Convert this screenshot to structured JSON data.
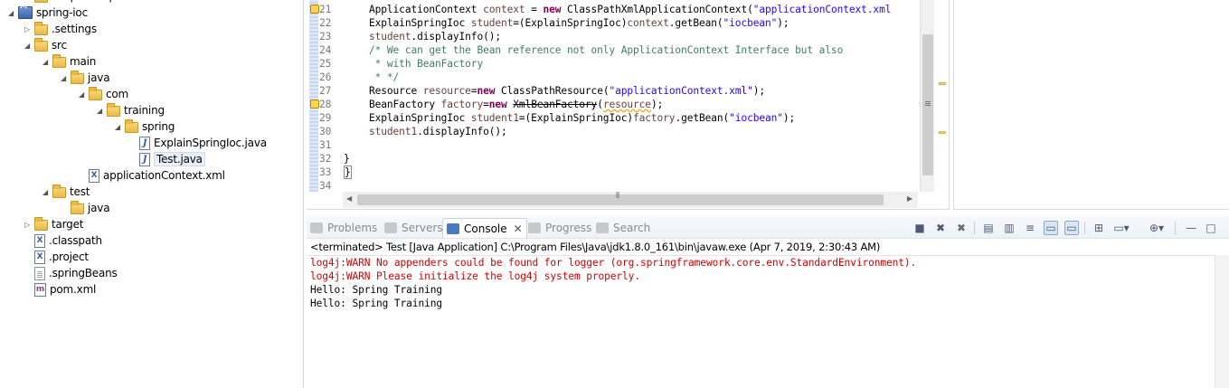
{
  "explorer": {
    "items": [
      {
        "label": "simplesetup",
        "depth": 1,
        "twisty": "",
        "icon": "folder"
      },
      {
        "label": "spring-ioc",
        "depth": 0,
        "twisty": "open",
        "icon": "project"
      },
      {
        "label": ".settings",
        "depth": 1,
        "twisty": "closed",
        "icon": "folder"
      },
      {
        "label": "src",
        "depth": 1,
        "twisty": "open",
        "icon": "folder"
      },
      {
        "label": "main",
        "depth": 2,
        "twisty": "open",
        "icon": "folder"
      },
      {
        "label": "java",
        "depth": 3,
        "twisty": "open",
        "icon": "folder"
      },
      {
        "label": "com",
        "depth": 4,
        "twisty": "open",
        "icon": "folder"
      },
      {
        "label": "training",
        "depth": 5,
        "twisty": "open",
        "icon": "folder"
      },
      {
        "label": "spring",
        "depth": 6,
        "twisty": "open",
        "icon": "folder"
      },
      {
        "label": "ExplainSpringIoc.java",
        "depth": 7,
        "twisty": "",
        "icon": "java"
      },
      {
        "label": "Test.java",
        "depth": 7,
        "twisty": "",
        "icon": "java",
        "selected": true
      },
      {
        "label": "applicationContext.xml",
        "depth": 4,
        "twisty": "",
        "icon": "xml"
      },
      {
        "label": "test",
        "depth": 2,
        "twisty": "open",
        "icon": "folder"
      },
      {
        "label": "java",
        "depth": 3,
        "twisty": "",
        "icon": "folder"
      },
      {
        "label": "target",
        "depth": 1,
        "twisty": "closed",
        "icon": "folder"
      },
      {
        "label": ".classpath",
        "depth": 1,
        "twisty": "",
        "icon": "xml"
      },
      {
        "label": ".project",
        "depth": 1,
        "twisty": "",
        "icon": "xml"
      },
      {
        "label": ".springBeans",
        "depth": 1,
        "twisty": "",
        "icon": "plain"
      },
      {
        "label": "pom.xml",
        "depth": 1,
        "twisty": "",
        "icon": "pom"
      }
    ]
  },
  "editor": {
    "lines": [
      {
        "n": "21",
        "marker": true,
        "tokens": [
          [
            "",
            "ApplicationContext "
          ],
          [
            "var",
            "context"
          ],
          [
            "",
            " = "
          ],
          [
            "kw",
            "new"
          ],
          [
            "",
            " ClassPathXmlApplicationContext("
          ],
          [
            "str",
            "\"applicationContext.xml"
          ]
        ]
      },
      {
        "n": "22",
        "tokens": [
          [
            "",
            "ExplainSpringIoc "
          ],
          [
            "var",
            "student"
          ],
          [
            "",
            "=(ExplainSpringIoc)"
          ],
          [
            "var",
            "context"
          ],
          [
            "",
            ".getBean("
          ],
          [
            "str",
            "\"iocbean\""
          ],
          [
            "",
            ");"
          ]
        ]
      },
      {
        "n": "23",
        "tokens": [
          [
            "var",
            "student"
          ],
          [
            "",
            ".displayInfo();"
          ]
        ]
      },
      {
        "n": "24",
        "tokens": [
          [
            "cmt",
            "/* We can get the Bean reference not only ApplicationContext Interface but also"
          ]
        ]
      },
      {
        "n": "25",
        "tokens": [
          [
            "cmt",
            " * with BeanFactory"
          ]
        ]
      },
      {
        "n": "26",
        "tokens": [
          [
            "cmt",
            " * */"
          ]
        ]
      },
      {
        "n": "27",
        "tokens": [
          [
            "",
            "Resource "
          ],
          [
            "var",
            "resource"
          ],
          [
            "",
            "="
          ],
          [
            "kw",
            "new"
          ],
          [
            "",
            " ClassPathResource("
          ],
          [
            "str",
            "\"applicationContext.xml\""
          ],
          [
            "",
            ");"
          ]
        ]
      },
      {
        "n": "28",
        "marker": true,
        "tokens": [
          [
            "",
            "BeanFactory "
          ],
          [
            "var",
            "factory"
          ],
          [
            "",
            "="
          ],
          [
            "kw",
            "new"
          ],
          [
            "",
            " "
          ],
          [
            "dep",
            "XmlBeanFactory"
          ],
          [
            "",
            "("
          ],
          [
            "var warnsq",
            "resource"
          ],
          [
            "",
            ");"
          ]
        ]
      },
      {
        "n": "29",
        "tokens": [
          [
            "",
            "ExplainSpringIoc "
          ],
          [
            "var",
            "student1"
          ],
          [
            "",
            "=(ExplainSpringIoc)"
          ],
          [
            "var",
            "factory"
          ],
          [
            "",
            ".getBean("
          ],
          [
            "str",
            "\"iocbean\""
          ],
          [
            "",
            ");"
          ]
        ]
      },
      {
        "n": "30",
        "tokens": [
          [
            "var",
            "student1"
          ],
          [
            "",
            ".displayInfo();"
          ]
        ]
      },
      {
        "n": "31",
        "tokens": []
      },
      {
        "n": "32",
        "tokens": [
          [
            "",
            "}"
          ]
        ],
        "indent": "outer"
      },
      {
        "n": "33",
        "tokens": [
          [
            "brace-box",
            "}"
          ]
        ],
        "indent": "class"
      },
      {
        "n": "34",
        "tokens": []
      }
    ]
  },
  "console": {
    "tabs": [
      {
        "label": "Problems",
        "icon": "problems-icon",
        "color": "#c8c8c8"
      },
      {
        "label": "Servers",
        "icon": "servers-icon",
        "color": "#c8c8c8"
      },
      {
        "label": "Console",
        "icon": "console-icon",
        "color": "#4a78c2",
        "active": true
      },
      {
        "label": "Progress",
        "icon": "progress-icon",
        "color": "#c8c8c8"
      },
      {
        "label": "Search",
        "icon": "search-icon",
        "color": "#c8c8c8"
      }
    ],
    "header": "<terminated> Test [Java Application] C:\\Program Files\\Java\\jdk1.8.0_161\\bin\\javaw.exe (Apr 7, 2019, 2:30:43 AM)",
    "output": [
      {
        "text": "log4j:WARN No appenders could be found for logger (org.springframework.core.env.StandardEnvironment).",
        "kind": "err"
      },
      {
        "text": "log4j:WARN Please initialize the log4j system properly.",
        "kind": "err"
      },
      {
        "text": "Hello: Spring Training",
        "kind": "out"
      },
      {
        "text": "Hello: Spring Training",
        "kind": "out"
      }
    ],
    "toolbar": [
      {
        "name": "terminate-button",
        "glyph": "■"
      },
      {
        "name": "remove-launch-button",
        "glyph": "✖"
      },
      {
        "name": "remove-all-terminated-button",
        "glyph": "✖"
      },
      {
        "name": "clear-console-button",
        "glyph": "▤"
      },
      {
        "name": "scroll-lock-button",
        "glyph": "▥"
      },
      {
        "name": "word-wrap-button",
        "glyph": "≡"
      },
      {
        "name": "show-on-stdout-button",
        "glyph": "▭",
        "pressed": true
      },
      {
        "name": "show-on-stderr-button",
        "glyph": "▭",
        "pressed": true
      },
      {
        "name": "pin-console-button",
        "glyph": "⊞"
      },
      {
        "name": "display-selected-console-button",
        "glyph": "▭▾"
      },
      {
        "name": "open-console-button",
        "glyph": "⊕▾"
      },
      {
        "name": "minimize-button",
        "glyph": "—"
      },
      {
        "name": "maximize-button",
        "glyph": "□"
      }
    ]
  }
}
